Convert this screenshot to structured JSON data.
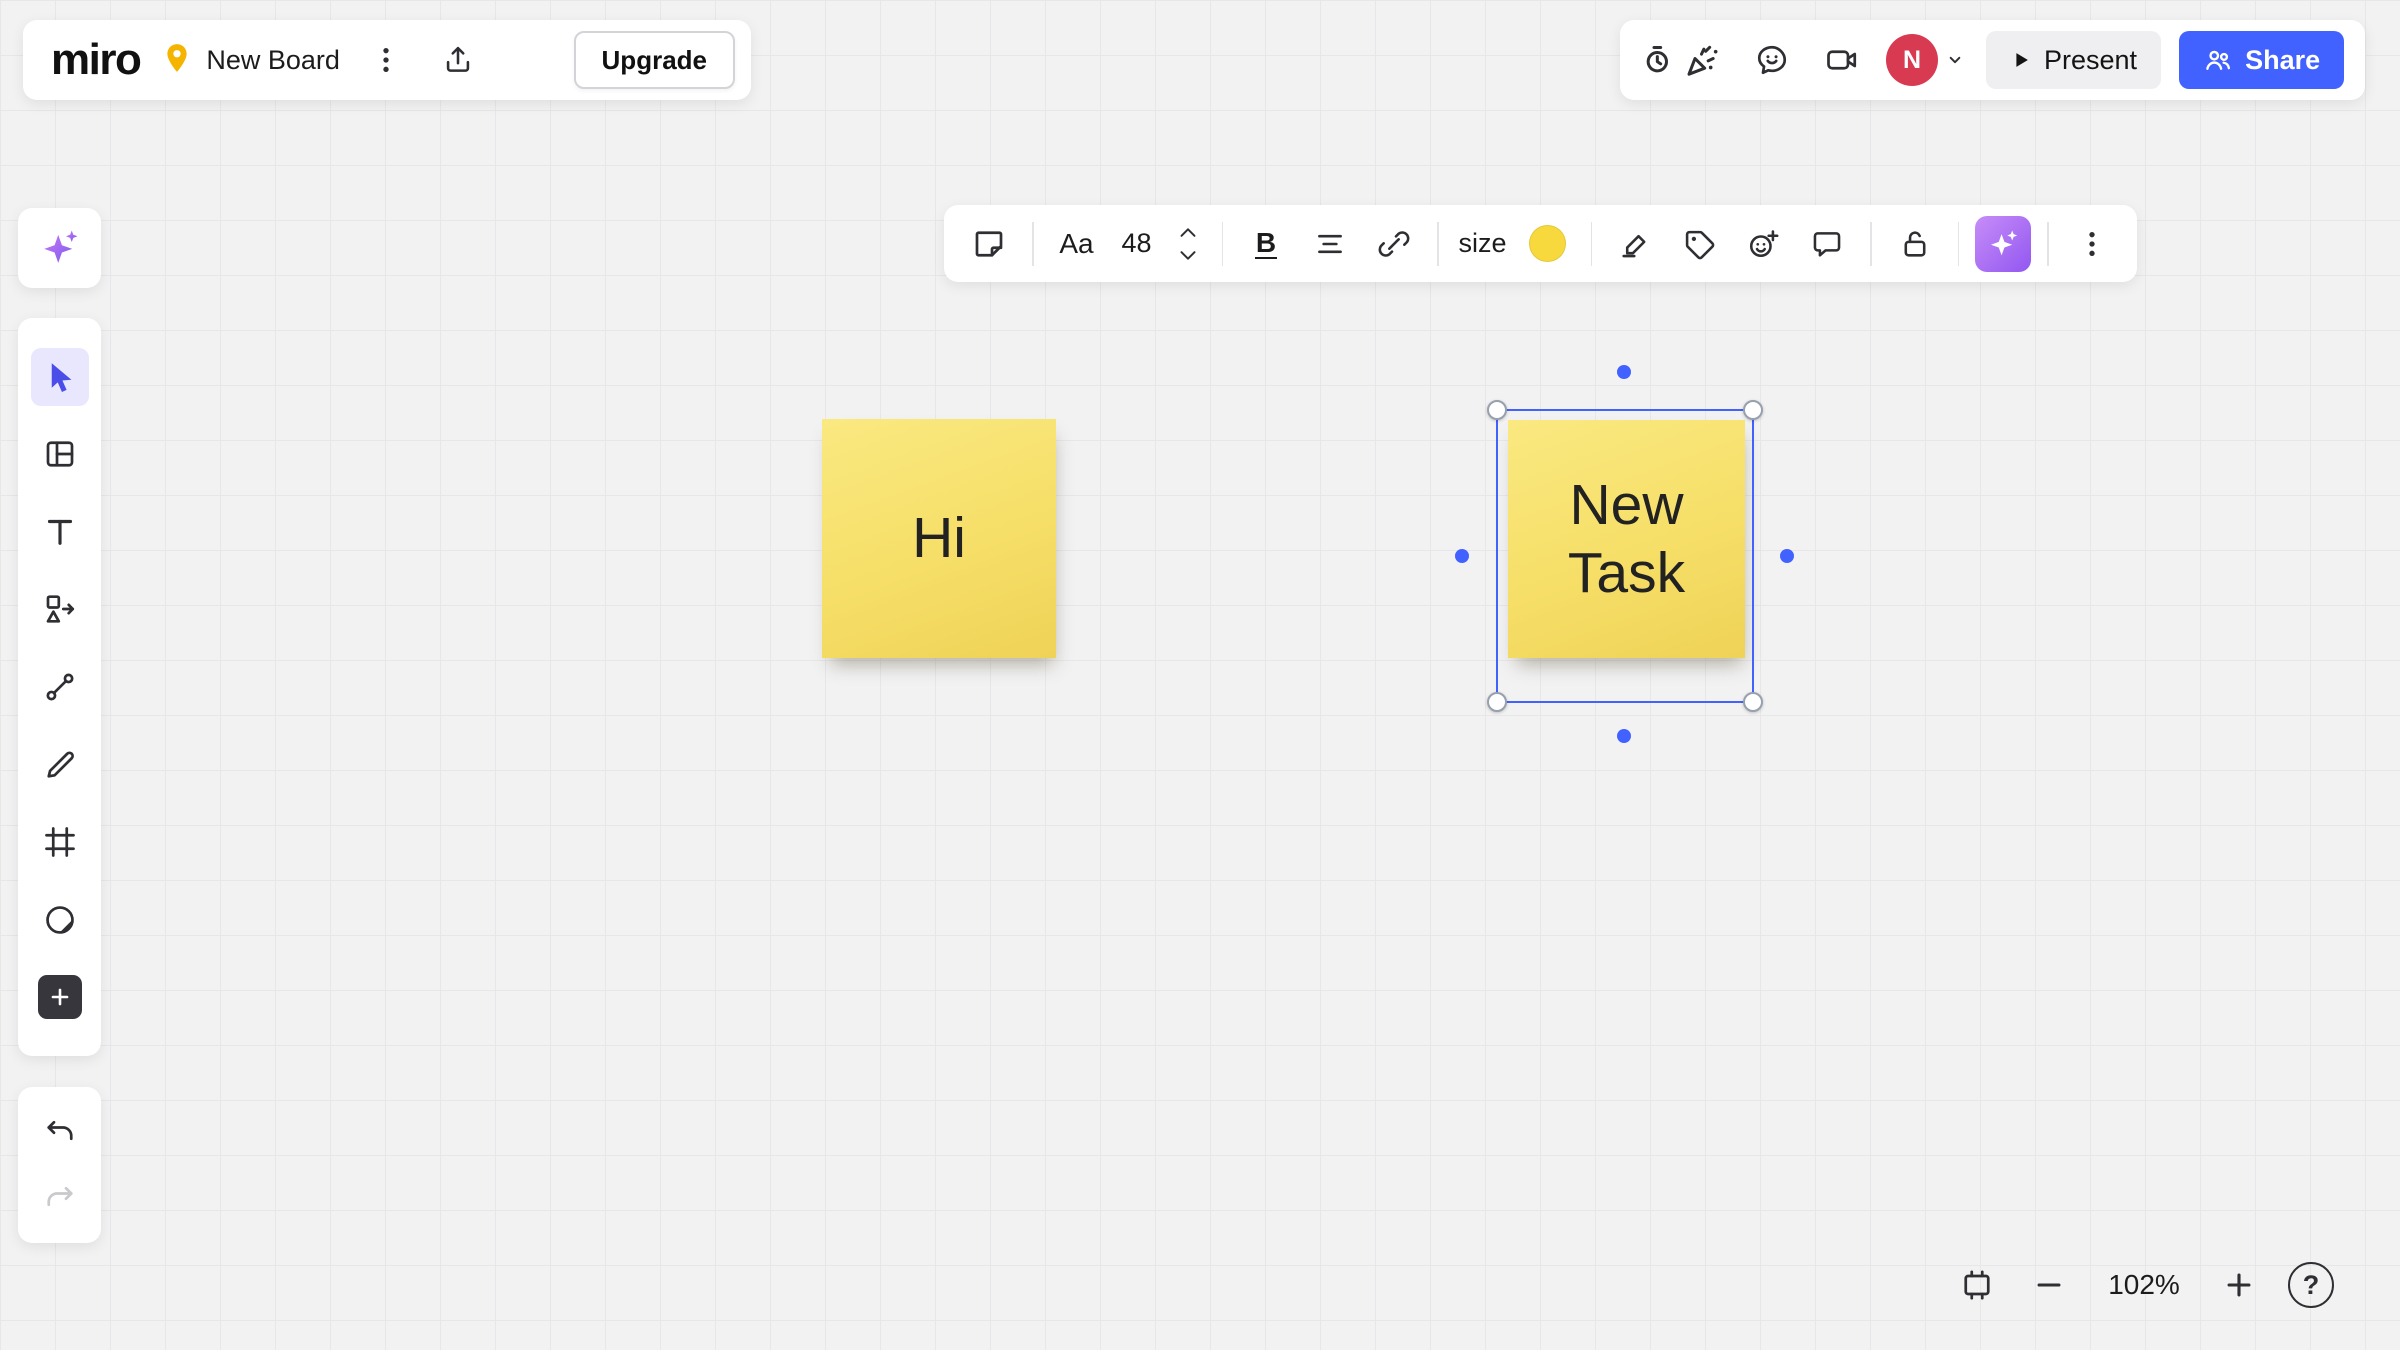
{
  "header": {
    "logo": "miro",
    "board": {
      "name": "New Board"
    },
    "upgrade_label": "Upgrade",
    "present_label": "Present",
    "share_label": "Share",
    "avatar_initial": "N"
  },
  "context_toolbar": {
    "text_style_label": "Aa",
    "font_size": "48",
    "bold_label": "B",
    "size_label": "size",
    "swatch_color": "#F8D93D"
  },
  "left_toolbar": {
    "active_tool": "select",
    "tools": [
      "ai-assistant",
      "select",
      "templates",
      "text",
      "shapes",
      "connection-line",
      "pen",
      "frame",
      "stickers",
      "more-tools",
      "undo",
      "redo"
    ]
  },
  "canvas": {
    "notes": [
      {
        "text": "Hi",
        "color": "#F7E26B",
        "selected": false
      },
      {
        "text": "New Task",
        "color": "#F7E26B",
        "selected": true
      }
    ]
  },
  "zoom_controls": {
    "zoom_level": "102%",
    "help_label": "?"
  },
  "colors": {
    "brand_blue": "#4262FF",
    "avatar_red": "#D83A52",
    "sticky_yellow": "#F7E26B",
    "selection_blue": "#4262FF",
    "ai_purple": "#9B5CF0",
    "pin_yellow": "#F5B400",
    "active_tool_bg": "#E8E7FD",
    "active_tool_fg": "#4B4DE8",
    "swatch_yellow": "#F8D93D"
  }
}
